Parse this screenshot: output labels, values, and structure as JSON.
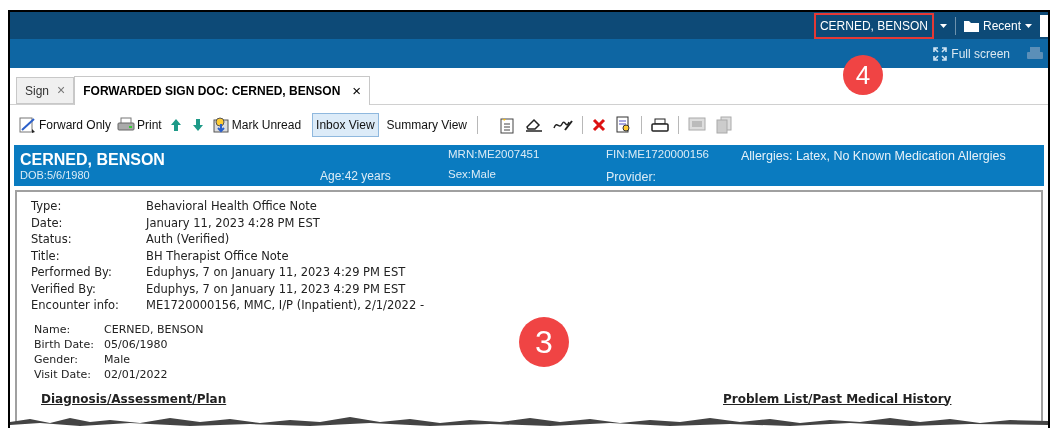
{
  "top_bar": {
    "patient": "CERNED, BENSON",
    "patient_highlighted": true,
    "recent": "Recent"
  },
  "action_bar": {
    "full_screen": "Full screen"
  },
  "tabs": [
    {
      "label": "Sign",
      "selected": false,
      "close": "×"
    },
    {
      "label": "FORWARDED SIGN DOC: CERNED, BENSON",
      "selected": true,
      "close": "×"
    }
  ],
  "toolbar": [
    {
      "kind": "forward",
      "label": "Forward Only",
      "selected": false
    },
    {
      "kind": "print",
      "label": "Print",
      "selected": false
    },
    {
      "kind": "up",
      "selected": false
    },
    {
      "kind": "down",
      "selected": false
    },
    {
      "kind": "unread",
      "label": "Mark Unread",
      "selected": false
    },
    {
      "kind": "text",
      "label": "Inbox View",
      "selected": true
    },
    {
      "kind": "text",
      "label": "Summary View",
      "selected": false
    },
    {
      "kind": "sep"
    },
    {
      "kind": "newdoc",
      "selected": false
    },
    {
      "kind": "erase",
      "selected": false
    },
    {
      "kind": "sign",
      "selected": false
    },
    {
      "kind": "sep"
    },
    {
      "kind": "delete",
      "selected": false
    },
    {
      "kind": "preview",
      "selected": false
    },
    {
      "kind": "sep"
    },
    {
      "kind": "printer",
      "selected": false
    },
    {
      "kind": "sep"
    },
    {
      "kind": "disabled1",
      "selected": false
    },
    {
      "kind": "disabled2",
      "selected": false
    }
  ],
  "banner": {
    "name": "CERNED, BENSON",
    "dob": "DOB:5/6/1980",
    "age": "Age:42 years",
    "mrn": "MRN:ME2007451",
    "sex": "Sex:Male",
    "fin": "FIN:ME1720000156",
    "provider": "Provider:",
    "allergies": "Allergies: Latex, No Known Medication Allergies"
  },
  "document": {
    "header": [
      {
        "label": "Type:",
        "value": "Behavioral Health Office Note"
      },
      {
        "label": "Date:",
        "value": "January 11, 2023 4:28 PM EST"
      },
      {
        "label": "Status:",
        "value": "Auth (Verified)"
      },
      {
        "label": "Title:",
        "value": "BH Therapist Office Note"
      },
      {
        "label": "Performed By:",
        "value": "Eduphys, 7 on January 11, 2023 4:29 PM EST"
      },
      {
        "label": "Verified By:",
        "value": "Eduphys, 7 on January 11, 2023 4:29 PM EST"
      },
      {
        "label": "Encounter info:",
        "value": "ME1720000156, MMC, I/P (Inpatient), 2/1/2022 -"
      }
    ],
    "patient": [
      {
        "label": "Name:",
        "value": "CERNED, BENSON"
      },
      {
        "label": "Birth Date:",
        "value": "05/06/1980"
      },
      {
        "label": "Gender:",
        "value": "Male"
      },
      {
        "label": "Visit Date:",
        "value": "02/01/2022"
      }
    ],
    "sections": [
      "Diagnosis/Assessment/Plan",
      "Problem List/Past Medical History"
    ]
  },
  "callouts": [
    "4",
    "3"
  ]
}
